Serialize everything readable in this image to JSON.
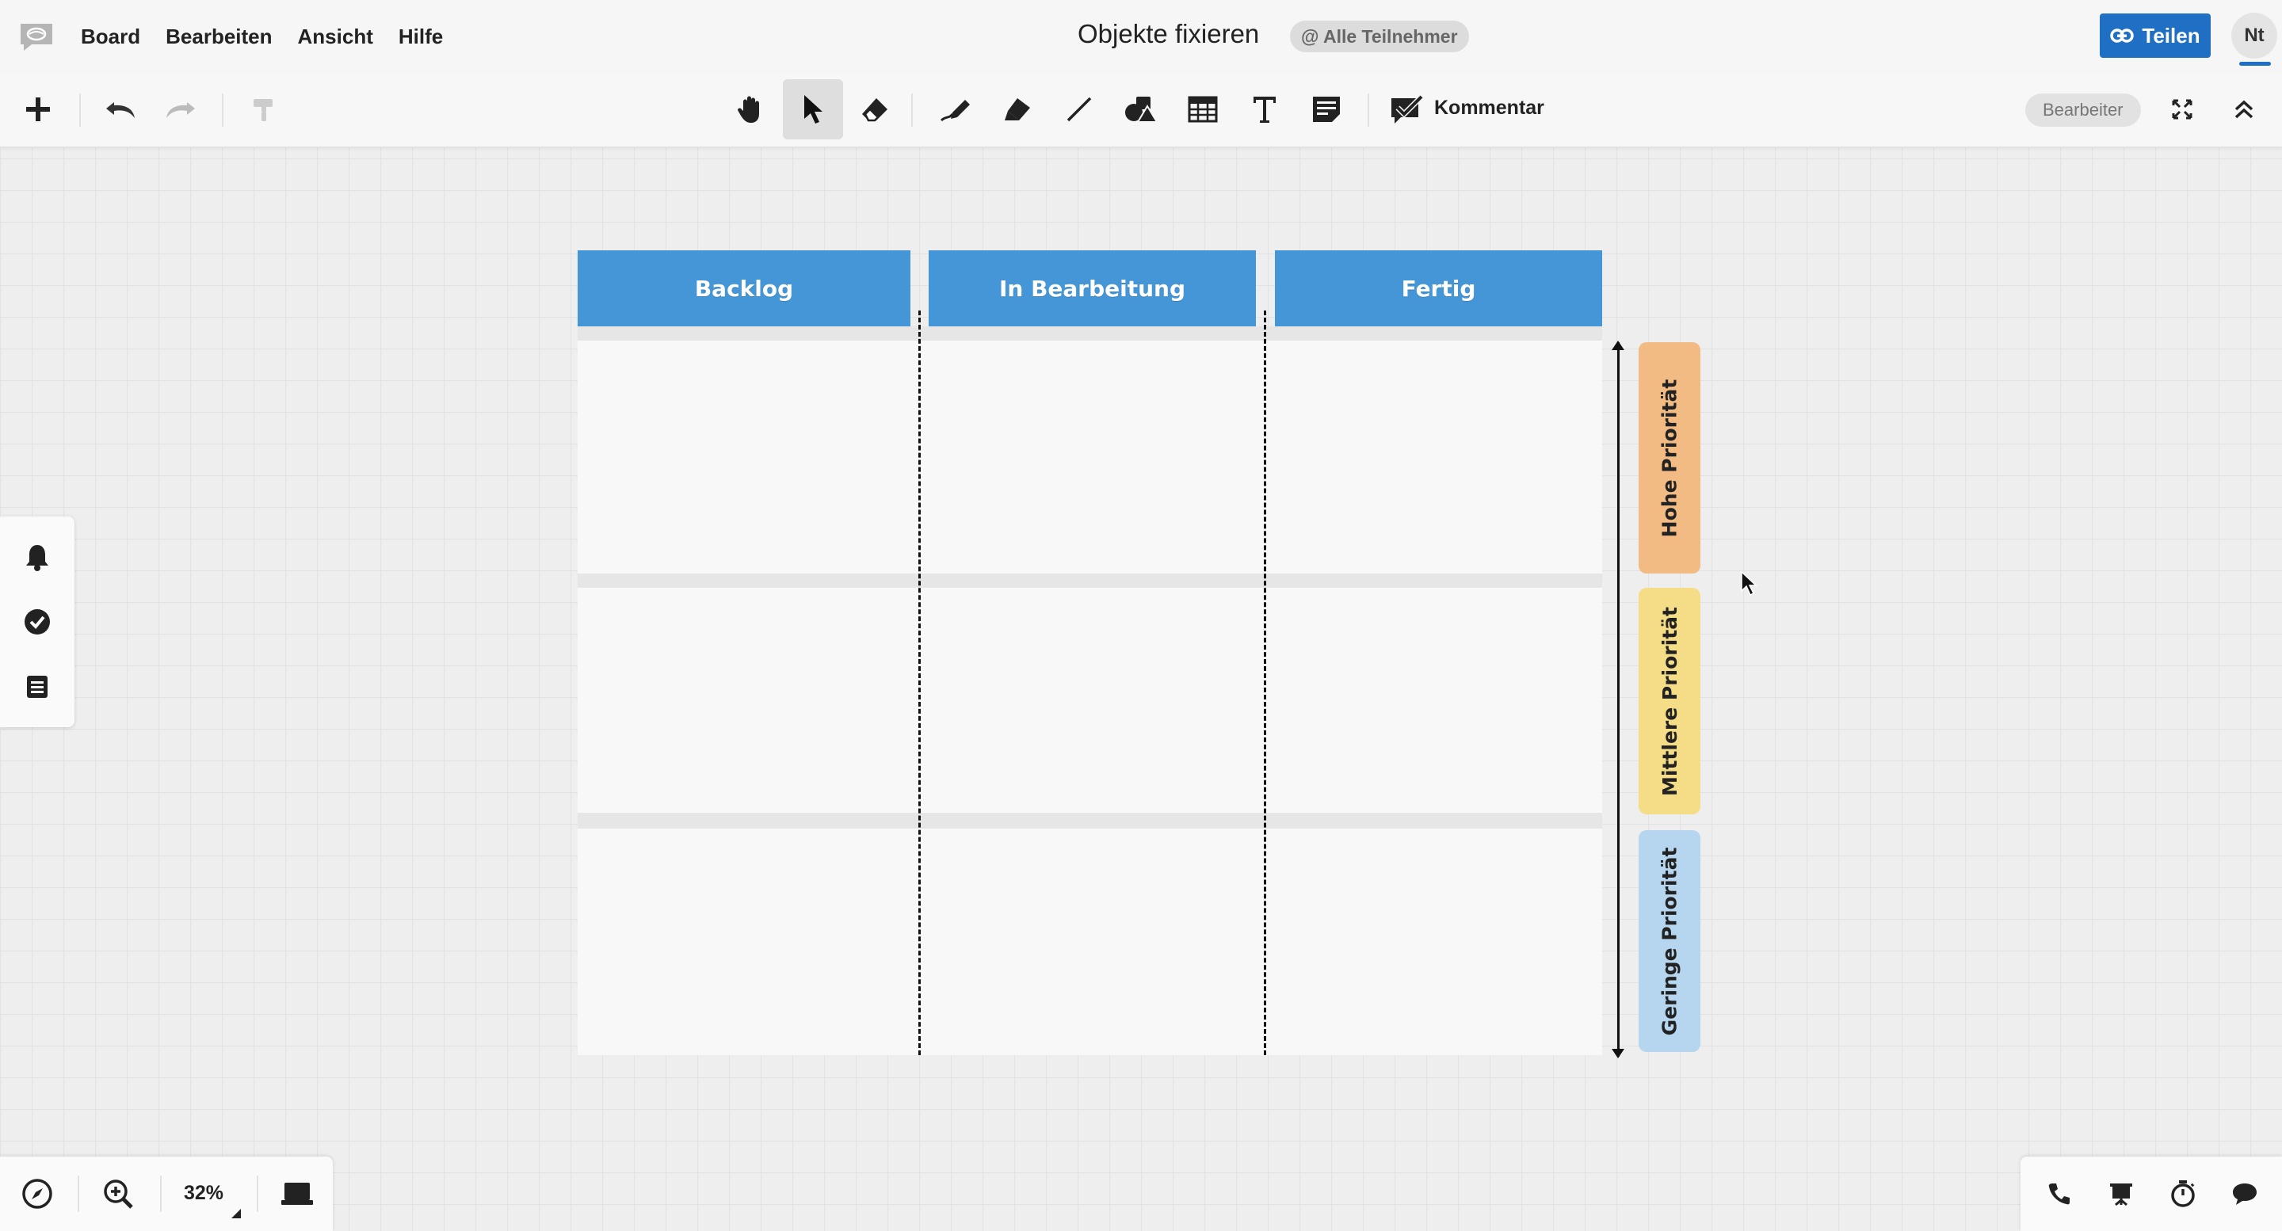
{
  "menubar": {
    "items": [
      "Board",
      "Bearbeiten",
      "Ansicht",
      "Hilfe"
    ],
    "title": "Objekte fixieren",
    "participants": "@ Alle Teilnehmer",
    "share_label": "Teilen",
    "avatar_initials": "Nt"
  },
  "toolbar": {
    "comment_label": "Kommentar",
    "role_label": "Bearbeiter",
    "active_tool": "select",
    "icons": [
      "add-icon",
      "undo-icon",
      "redo-icon",
      "format-painter-icon",
      "hand-icon",
      "pointer-icon",
      "eraser-icon",
      "pen-icon",
      "highlighter-icon",
      "line-icon",
      "shapes-icon",
      "table-icon",
      "text-icon",
      "sticky-note-icon",
      "comment-icon",
      "fullscreen-icon",
      "collapse-icon"
    ]
  },
  "side_panel": {
    "icons": [
      "bell-icon",
      "check-circle-icon",
      "list-icon"
    ]
  },
  "bottom_bar": {
    "zoom": "32%",
    "icons": [
      "navigator-icon",
      "zoom-in-icon",
      "presenter-icon",
      "phone-icon",
      "presentation-icon",
      "timer-icon",
      "chat-icon"
    ]
  },
  "board": {
    "columns": [
      "Backlog",
      "In Bearbeitung",
      "Fertig"
    ],
    "priorities": [
      {
        "label": "Hohe Priorität",
        "color": "#f2bb84"
      },
      {
        "label": "Mittlere Priorität",
        "color": "#f4dd86"
      },
      {
        "label": "Geringe Priorität",
        "color": "#b5d6ee"
      }
    ],
    "header_color": "#4596d6"
  },
  "colors": {
    "accent": "#1f6fc4",
    "canvas": "#eeeeee"
  }
}
